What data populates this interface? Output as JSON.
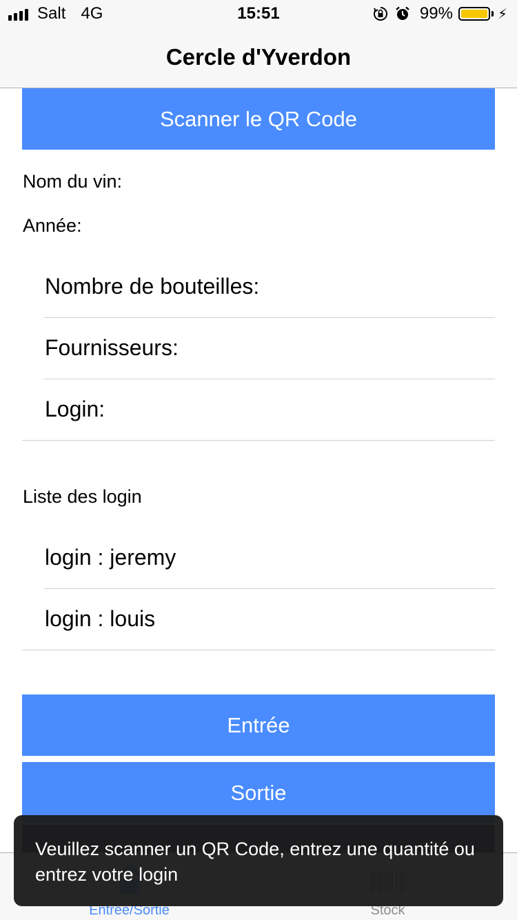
{
  "status_bar": {
    "carrier": "Salt",
    "network": "4G",
    "time": "15:51",
    "battery_percent": "99%",
    "battery_level": 0.99,
    "icons": [
      "signal-icon",
      "orientation-lock-icon",
      "alarm-icon",
      "battery-icon",
      "charging-icon"
    ]
  },
  "nav": {
    "title": "Cercle d'Yverdon"
  },
  "scan_button": {
    "label": "Scanner le QR Code"
  },
  "info": {
    "wine_name_label": "Nom du vin:",
    "year_label": "Année:"
  },
  "form_rows": [
    {
      "label": "Nombre de bouteilles:"
    },
    {
      "label": "Fournisseurs:"
    },
    {
      "label": "Login:"
    }
  ],
  "login_list": {
    "header": "Liste des login",
    "items": [
      {
        "label": "login : jeremy"
      },
      {
        "label": "login : louis"
      }
    ]
  },
  "actions": {
    "entry_label": "Entrée",
    "exit_label": "Sortie"
  },
  "tabs": [
    {
      "label": "Entree/Sortie",
      "icon": "home-icon",
      "active": true
    },
    {
      "label": "Stock",
      "icon": "barcode-icon",
      "active": false
    }
  ],
  "toast": {
    "message": "Veuillez scanner un QR Code, entrez une quantité ou entrez votre login"
  },
  "colors": {
    "accent": "#4a8cff",
    "bar_background": "#f7f7f7",
    "battery_fill": "#f7c800",
    "toast_background": "#1c1c1c",
    "tab_active": "#4a8cff",
    "tab_inactive": "#8e8e93"
  }
}
